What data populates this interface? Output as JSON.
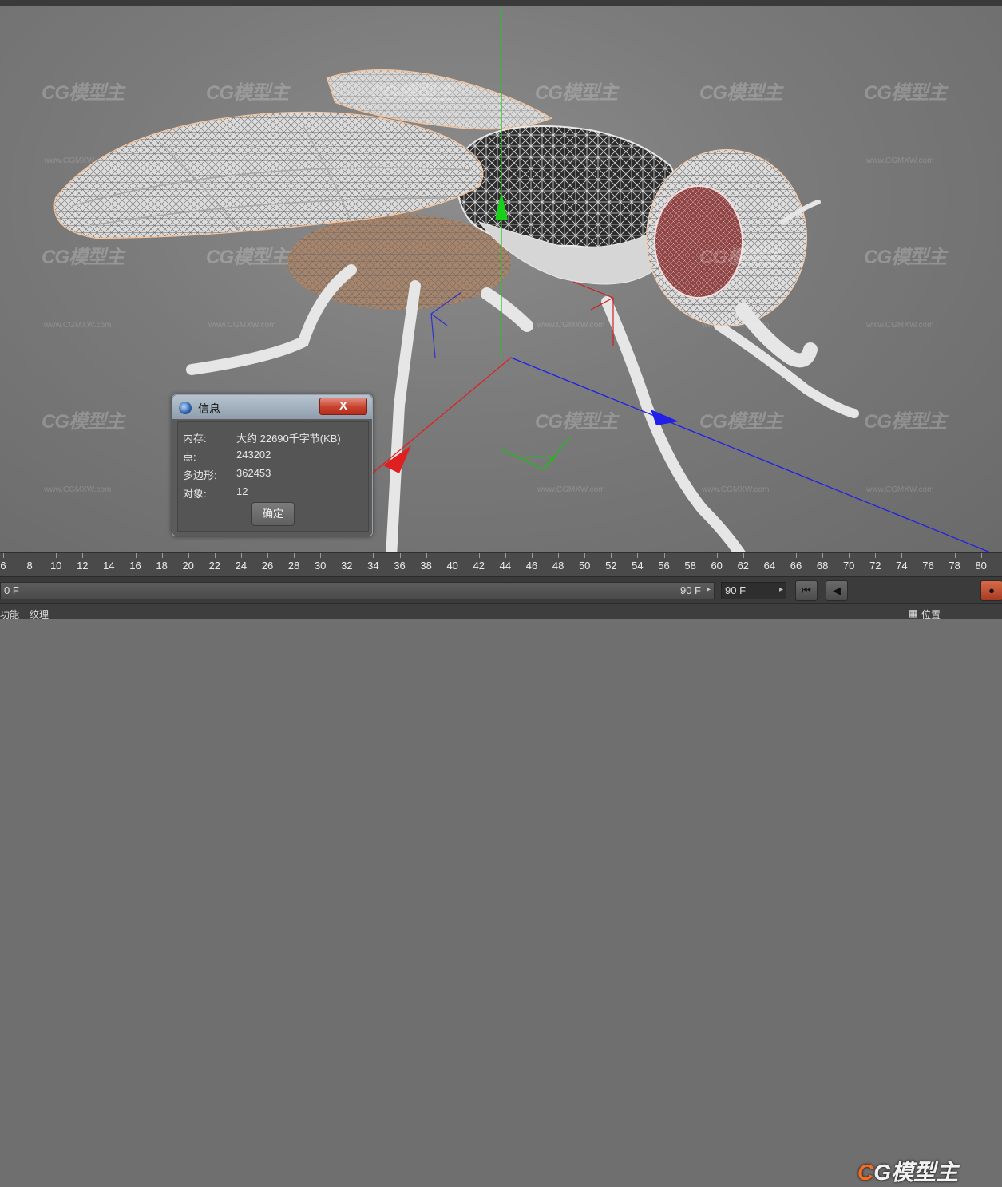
{
  "watermark": {
    "brand": "CG模型主",
    "url": "www.CGMXW.com"
  },
  "dialog": {
    "title": "信息",
    "close_label": "X",
    "rows": [
      {
        "label": "内存:",
        "value": "大约 22690千字节(KB)"
      },
      {
        "label": "点:",
        "value": "243202"
      },
      {
        "label": "多边形:",
        "value": "362453"
      },
      {
        "label": "对象:",
        "value": "12"
      }
    ],
    "ok_label": "确定"
  },
  "timeline": {
    "ticks": [
      "6",
      "8",
      "10",
      "12",
      "14",
      "16",
      "18",
      "20",
      "22",
      "24",
      "26",
      "28",
      "30",
      "32",
      "34",
      "36",
      "38",
      "40",
      "42",
      "44",
      "46",
      "48",
      "50",
      "52",
      "54",
      "56",
      "58",
      "60",
      "62",
      "64",
      "66",
      "68",
      "70",
      "72",
      "74",
      "76",
      "78",
      "80"
    ],
    "start_frame": "0 F",
    "end_frame": "90 F",
    "max_frame_field": "90 F"
  },
  "statusbar": {
    "items": [
      "功能",
      "纹理"
    ],
    "right_label": "位置"
  },
  "colors": {
    "axis_x": "#e02020",
    "axis_y": "#18d018",
    "axis_z": "#2020e8",
    "wire": "#e8e8e8",
    "eye": "#9a4040"
  }
}
